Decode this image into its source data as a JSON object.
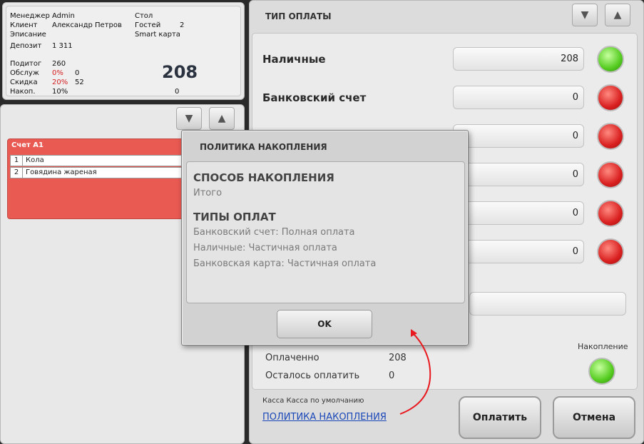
{
  "info": {
    "manager_label": "Менеджер",
    "manager": "Admin",
    "client_label": "Клиент",
    "client": "Александр Петров",
    "writeoff_label": "Эписание",
    "deposit_label": "Депозит",
    "deposit": "1 311",
    "table_label": "Стол",
    "guests_label": "Гостей",
    "guests": "2",
    "card": "Smart карта",
    "subtotal_label": "Подитог",
    "subtotal": "260",
    "service_label": "Обслуж",
    "service_pct": "0%",
    "service": "0",
    "discount_label": "Скидка",
    "discount_pct": "20%",
    "discount": "52",
    "accum_label": "Накоп.",
    "accum_pct": "10%",
    "accum": "0",
    "total": "208"
  },
  "order": {
    "header": "Счет А1",
    "items": [
      {
        "num": "1",
        "name": "Кола"
      },
      {
        "num": "2",
        "name": "Говядина жареная"
      }
    ]
  },
  "payment": {
    "title": "ТИП ОПЛАТЫ",
    "methods": [
      {
        "label": "Наличные",
        "value": "208",
        "status": "green"
      },
      {
        "label": "Банковский счет",
        "value": "0",
        "status": "red"
      },
      {
        "label": "",
        "value": "0",
        "status": "red"
      },
      {
        "label": "",
        "value": "0",
        "status": "red"
      },
      {
        "label": "",
        "value": "0",
        "status": "red"
      },
      {
        "label": "",
        "value": "0",
        "status": "red"
      }
    ],
    "paid_label": "Оплаченно",
    "paid": "208",
    "remaining_label": "Осталось оплатить",
    "remaining": "0",
    "accumulation_label": "Накопление",
    "kassa": "Касса  Касса по умолчанию",
    "policy_link": "ПОЛИТИКА НАКОПЛЕНИЯ",
    "pay_button": "Оплатить",
    "cancel_button": "Отмена"
  },
  "dialog": {
    "title": "ПОЛИТИКА НАКОПЛЕНИЯ",
    "method_heading": "СПОСОБ НАКОПЛЕНИЯ",
    "method_value": "Итого",
    "types_heading": "ТИПЫ ОПЛАТ",
    "types": [
      "Банковский счет: Полная оплата",
      "Наличные: Частичная оплата",
      "Банковская карта: Частичная оплата"
    ],
    "ok": "OK"
  },
  "colors": {
    "accent_red": "#e95a52",
    "link_blue": "#1a47b8",
    "annotation_red": "#e8191f"
  },
  "icons": {
    "scroll_down": "chevron-down-icon",
    "scroll_up": "chevron-up-icon"
  }
}
